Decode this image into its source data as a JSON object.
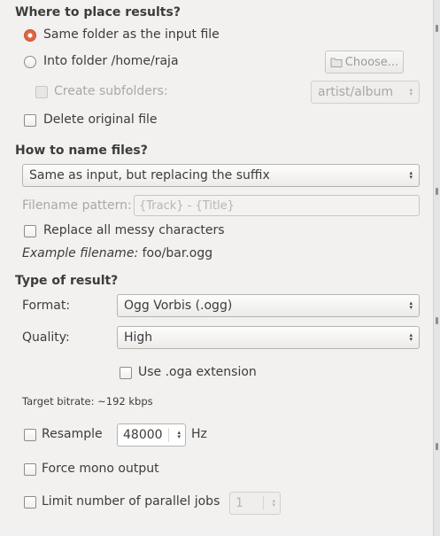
{
  "placement": {
    "heading": "Where to place results?",
    "same_folder": "Same folder as the input file",
    "into_folder": "Into folder /home/raja",
    "choose_button": "Choose...",
    "create_subfolders": "Create subfolders:",
    "subfolder_pattern": "artist/album",
    "delete_original": "Delete original file"
  },
  "naming": {
    "heading": "How to name files?",
    "naming_option": "Same as input, but replacing the suffix",
    "pattern_label": "Filename pattern:",
    "pattern_value": "{Track} - {Title}",
    "replace_messy": "Replace all messy characters",
    "example_label": "Example filename:",
    "example_value": "foo/bar.ogg"
  },
  "result": {
    "heading": "Type of result?",
    "format_label": "Format:",
    "format_value": "Ogg Vorbis (.ogg)",
    "quality_label": "Quality:",
    "quality_value": "High",
    "oga_extension": "Use .oga extension",
    "target_bitrate": "Target bitrate: ~192 kbps",
    "resample_label": "Resample",
    "resample_value": "48000",
    "resample_unit": "Hz",
    "force_mono": "Force mono output",
    "parallel_jobs": "Limit number of parallel jobs",
    "parallel_jobs_value": "1"
  },
  "icons": {
    "folder": "folder-icon",
    "spin_up": "▴",
    "spin_down": "▾"
  },
  "colors": {
    "radio_selected": "#e0663f",
    "background": "#f2f1f0"
  }
}
